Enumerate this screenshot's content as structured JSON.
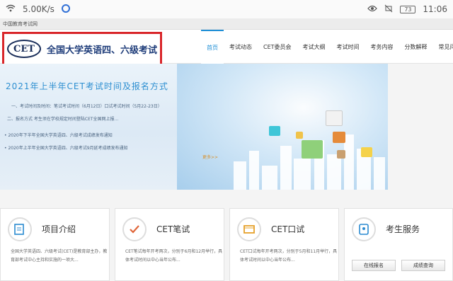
{
  "status_bar": {
    "speed": "5.00K/s",
    "battery": "73",
    "time": "11:06"
  },
  "url_bar": {
    "text": "中国教育考试网"
  },
  "header": {
    "logo_text": "CET",
    "logo_title": "全国大学英语四、六级考试",
    "nav": [
      "首页",
      "考试动态",
      "CET委员会",
      "考试大纲",
      "考试时间",
      "考务内容",
      "分数解释",
      "常见问题"
    ]
  },
  "banner": {
    "title": "2021年上半年CET考试时间及报名方式",
    "line1": "一、考试时间及时间：笔试考试时间（6月12日）口试考试时间（5月22-23日）",
    "line2": "二、报名方式  考生须在学校规定时间登陆CET全国网上报...",
    "bullet1": "• 2020年下半年全国大学英语四、六级考试成绩发布通知",
    "bullet2": "• 2020年上半年全国大学英语四、六级考试9月延考成绩发布通知",
    "more": "更多>>"
  },
  "cards": [
    {
      "title": "项目介绍",
      "desc": "全国大学英语四、六级考试(CET)是教育部主办，教育部考试中心主持和实施的一项大..."
    },
    {
      "title": "CET笔试",
      "desc": "CET笔试每年开考两次，分别于6月和12月举行，具体考试时间以中心当年公布..."
    },
    {
      "title": "CET口试",
      "desc": "CET口试每年开考两次，分别于5月和11月举行，具体考试时间以中心当年公布..."
    },
    {
      "title": "考生服务",
      "buttons": [
        "在线报名",
        "成绩查询"
      ]
    }
  ],
  "colors": {
    "accent": "#1f8fd6",
    "highlight": "#d9262a"
  }
}
